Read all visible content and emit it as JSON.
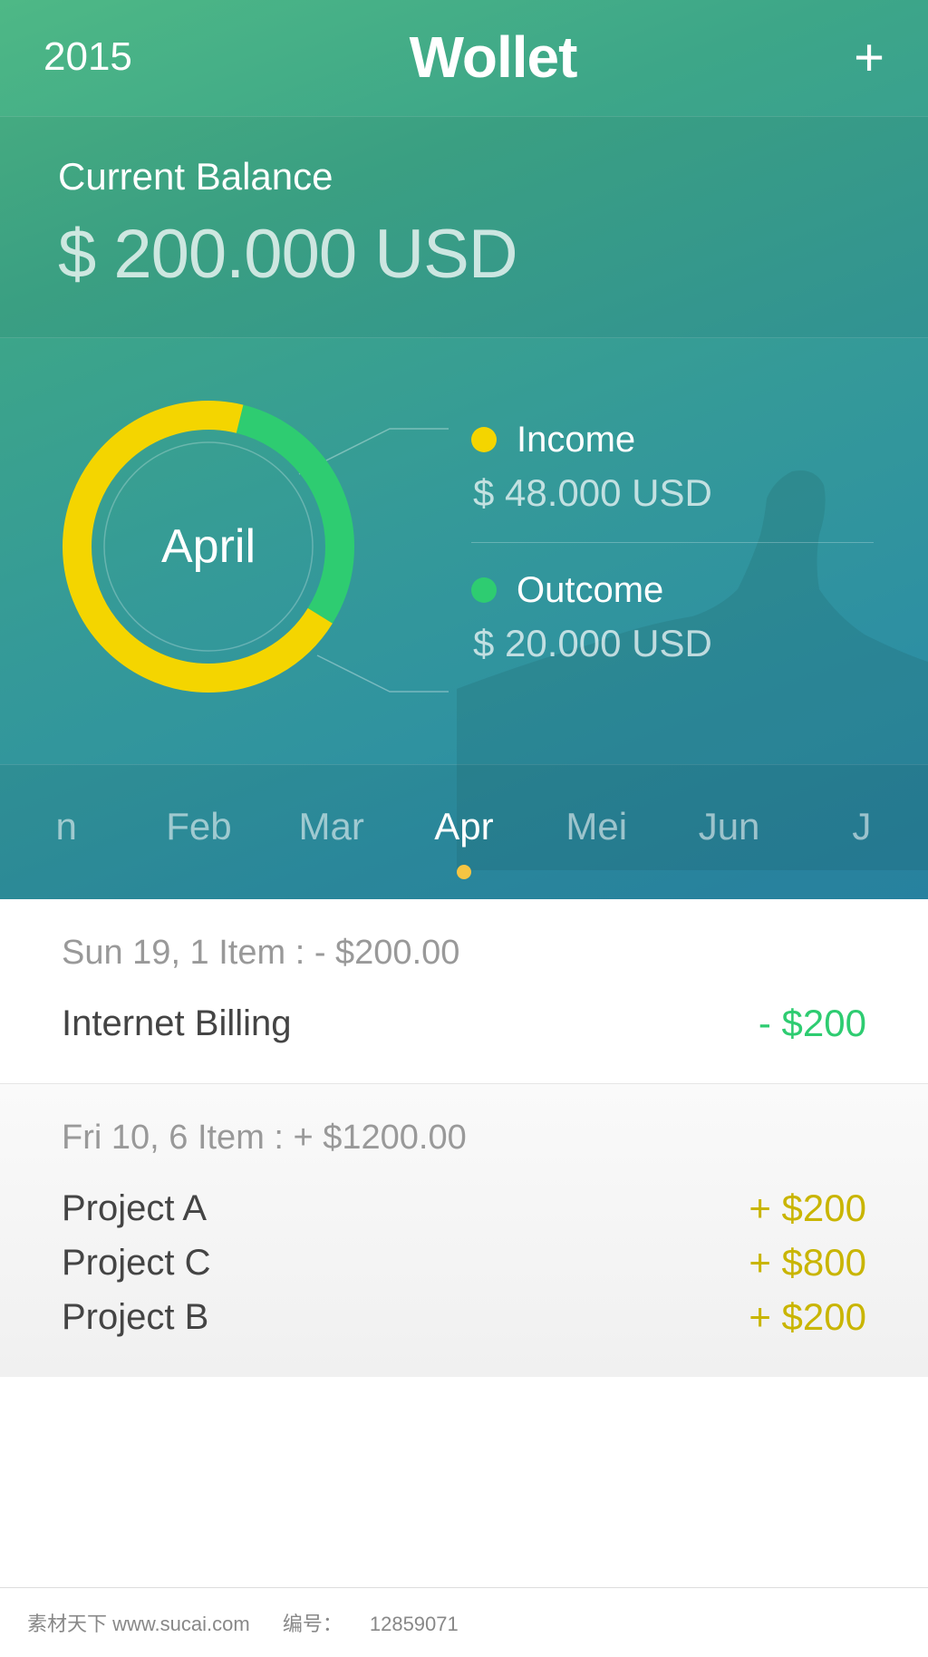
{
  "header": {
    "year": "2015",
    "brand": "Wollet",
    "add_icon": "+"
  },
  "balance": {
    "label": "Current Balance",
    "value": "$ 200.000 USD"
  },
  "chart_data": {
    "type": "pie",
    "title": "April",
    "series": [
      {
        "name": "Income",
        "value": 48000,
        "display": "$ 48.000 USD",
        "color": "#f4d500",
        "fraction": 0.7
      },
      {
        "name": "Outcome",
        "value": 20000,
        "display": "$ 20.000 USD",
        "color": "#2ecc71",
        "fraction": 0.3
      }
    ]
  },
  "months": {
    "items": [
      "n",
      "Feb",
      "Mar",
      "Apr",
      "Mei",
      "Jun",
      "J"
    ],
    "active_index": 3
  },
  "transactions": {
    "groups": [
      {
        "summary": "Sun 19, 1 Item : - $200.00",
        "rows": [
          {
            "name": "Internet Billing",
            "amount": "- $200",
            "dir": "neg"
          }
        ]
      },
      {
        "summary": "Fri 10, 6 Item : + $1200.00",
        "rows": [
          {
            "name": "Project A",
            "amount": "+ $200",
            "dir": "pos"
          },
          {
            "name": "Project C",
            "amount": "+ $800",
            "dir": "pos"
          },
          {
            "name": "Project B",
            "amount": "+ $200",
            "dir": "pos"
          }
        ]
      }
    ]
  },
  "footer": {
    "site": "素材天下 www.sucai.com",
    "id_label": "编号：",
    "id": "12859071"
  }
}
